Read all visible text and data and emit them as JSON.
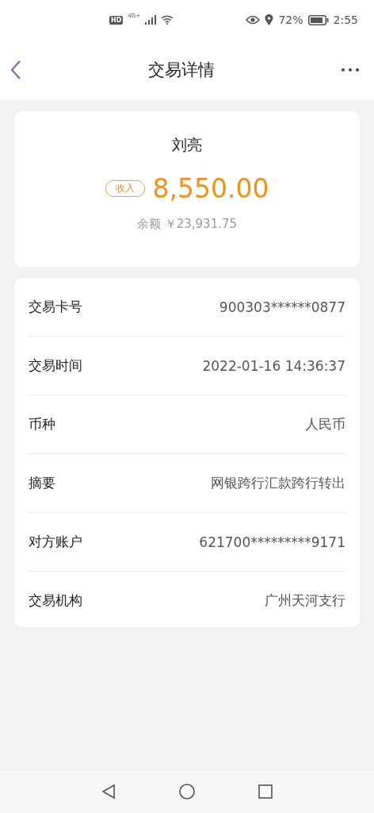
{
  "status_bar": {
    "hd": "HD",
    "network": "4G+",
    "battery": "72%",
    "time": "2:55"
  },
  "header": {
    "title": "交易详情"
  },
  "summary": {
    "name": "刘亮",
    "badge": "收入",
    "amount": "8,550.00",
    "balance_label": "余额",
    "balance": "￥23,931.75"
  },
  "details": [
    {
      "label": "交易卡号",
      "value": "900303******0877"
    },
    {
      "label": "交易时间",
      "value": "2022-01-16 14:36:37"
    },
    {
      "label": "币种",
      "value": "人民币"
    },
    {
      "label": "摘要",
      "value": "网银跨行汇款跨行转出"
    },
    {
      "label": "对方账户",
      "value": "621700*********9171"
    },
    {
      "label": "交易机构",
      "value": "广州天河支行"
    }
  ]
}
